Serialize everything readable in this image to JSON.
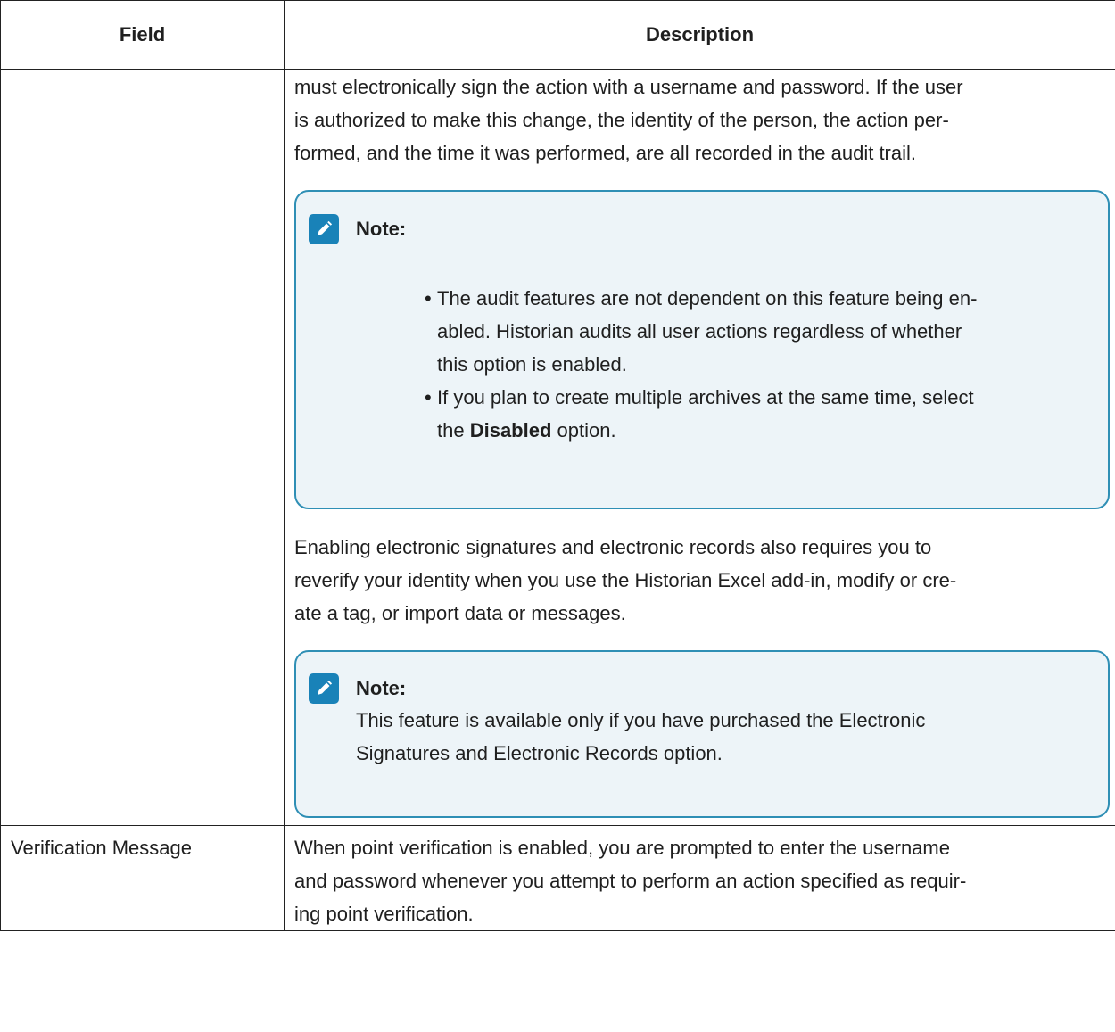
{
  "table": {
    "headers": {
      "field": "Field",
      "description": "Description"
    },
    "row1": {
      "field": "",
      "para1": "must electronically sign the action with a username and password. If the user is authorized to make this change, the identity of the person, the action per-formed, and the time it was performed, are all recorded in the audit trail.",
      "para1_lines": [
        "must electronically sign the action with a username and password. If the user",
        "is authorized to make this change, the identity of the person, the action per-",
        "formed, and the time it was performed, are all recorded in the audit trail."
      ],
      "note1": {
        "label": "Note:",
        "bullet1_lines": [
          "The audit features are not dependent on this feature being en-",
          "abled. Historian audits all user actions regardless of whether",
          "this option is enabled."
        ],
        "bullet2_lines_a": "If you plan to create multiple archives at the same time, select",
        "bullet2_pre": "the ",
        "bullet2_bold": "Disabled",
        "bullet2_post": " option."
      },
      "para2_lines": [
        "Enabling electronic signatures and electronic records also requires you to",
        "reverify your identity when you use the Historian Excel add-in, modify or cre-",
        "ate a tag, or import data or messages."
      ],
      "note2": {
        "label": "Note:",
        "text_lines": [
          "This feature is available only if you have purchased the Electronic",
          "Signatures and Electronic Records option."
        ]
      }
    },
    "row2": {
      "field": "Verification Message",
      "desc_lines": [
        "When point verification is enabled, you are prompted to enter the username",
        "and password whenever you attempt to perform an action specified as requir-",
        "ing point verification."
      ]
    }
  },
  "colors": {
    "note_border": "#2f8fb5",
    "note_background": "#edf4f8",
    "note_icon": "#1982b8"
  },
  "icons": {
    "note": "pencil-note-icon"
  }
}
